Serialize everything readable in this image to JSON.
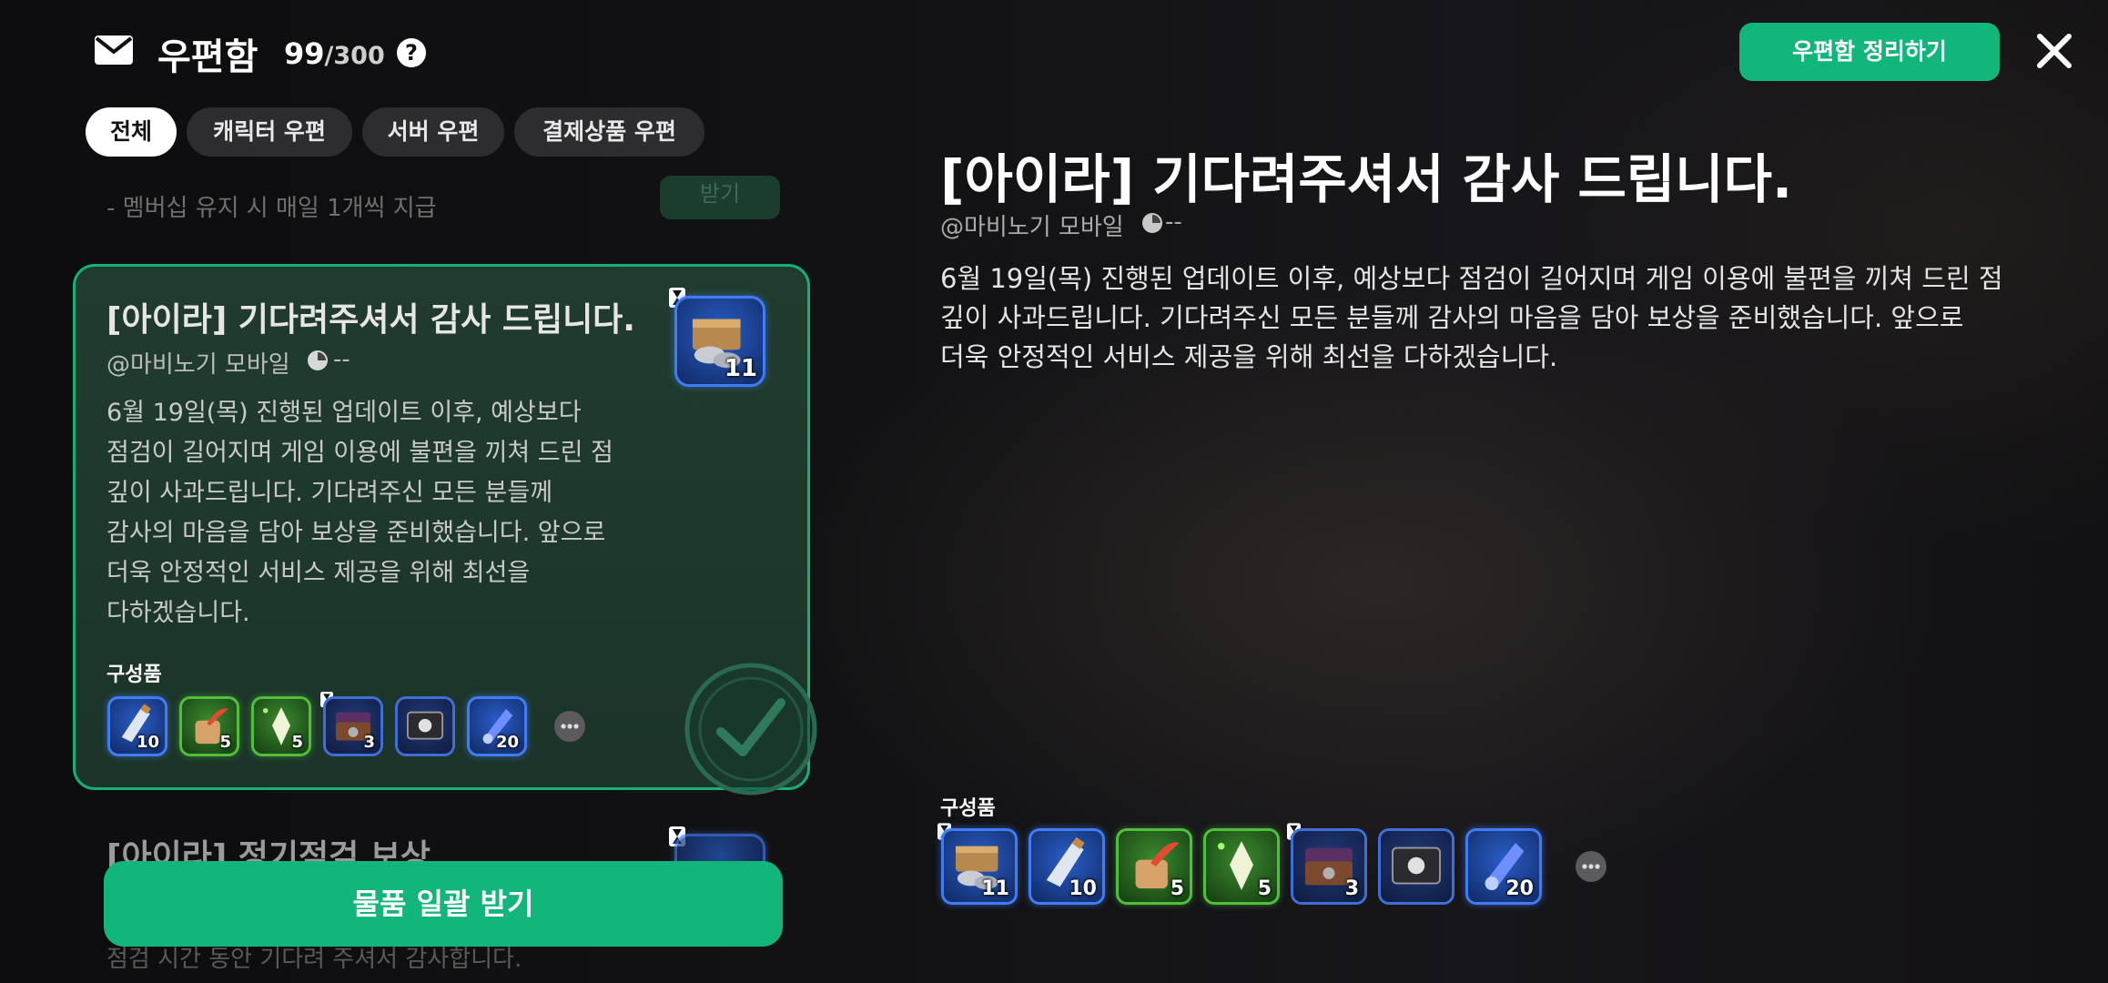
{
  "header": {
    "title": "우편함",
    "count": "99",
    "capacity": "/300",
    "organize_label": "우편함 정리하기",
    "icons": [
      "mail-icon",
      "help-icon",
      "close-icon"
    ]
  },
  "tabs": [
    {
      "label": "전체",
      "active": true
    },
    {
      "label": "캐릭터 우편",
      "active": false
    },
    {
      "label": "서버 우편",
      "active": false
    },
    {
      "label": "결제상품 우편",
      "active": false
    }
  ],
  "faded_prev": {
    "text": "- 멤버십 유지 시 매일 1개씩 지급",
    "button": "받기"
  },
  "selected_mail": {
    "title": "[아이라] 기다려주셔서 감사 드립니다.",
    "sender": "@마비노기 모바일",
    "time": "--",
    "body": [
      "6월 19일(목) 진행된 업데이트 이후, 예상보다",
      "점검이 길어지며 게임 이용에 불편을 끼쳐 드린 점",
      "깊이 사과드립니다.  기다려주신 모든 분들께",
      "감사의 마음을 담아 보상을 준비했습니다. 앞으로",
      "더욱 안정적인 서비스 제공을 위해 최선을",
      "다하겠습니다."
    ],
    "thumbnail_qty": "11",
    "components_label": "구성품",
    "items": [
      {
        "name": "potion-bottle-icon",
        "qty": "10",
        "rarity": "blue"
      },
      {
        "name": "feather-pouch-icon",
        "qty": "5",
        "rarity": "green"
      },
      {
        "name": "crystal-shard-icon",
        "qty": "5",
        "rarity": "green"
      },
      {
        "name": "treasure-chest-icon",
        "qty": "3",
        "rarity": "navy",
        "timed": true
      },
      {
        "name": "card-pack-icon",
        "qty": "",
        "rarity": "navy"
      },
      {
        "name": "mana-potion-icon",
        "qty": "20",
        "rarity": "blue"
      }
    ]
  },
  "next_mail": {
    "title": "[아이라] 정기점검 보상",
    "faded_text": "점검 시간 동안 기다려 주셔서 감사합니다."
  },
  "claim_all_label": "물품 일괄 받기",
  "detail": {
    "title": "[아이라] 기다려주셔서 감사 드립니다.",
    "sender": "@마비노기 모바일",
    "time": "--",
    "body": [
      "6월 19일(목) 진행된 업데이트 이후, 예상보다 점검이 길어지며 게임 이용에 불편을 끼쳐 드린 점",
      "깊이 사과드립니다.  기다려주신 모든 분들께 감사의 마음을 담아 보상을 준비했습니다. 앞으로",
      "더욱 안정적인 서비스 제공을 위해 최선을 다하겠습니다."
    ],
    "components_label": "구성품",
    "items": [
      {
        "name": "coin-box-icon",
        "qty": "11",
        "rarity": "blue",
        "timed": true
      },
      {
        "name": "potion-bottle-icon",
        "qty": "10",
        "rarity": "blue"
      },
      {
        "name": "feather-pouch-icon",
        "qty": "5",
        "rarity": "green"
      },
      {
        "name": "crystal-shard-icon",
        "qty": "5",
        "rarity": "green"
      },
      {
        "name": "treasure-chest-icon",
        "qty": "3",
        "rarity": "navy",
        "timed": true
      },
      {
        "name": "card-pack-icon",
        "qty": "",
        "rarity": "navy"
      },
      {
        "name": "mana-potion-icon",
        "qty": "20",
        "rarity": "blue"
      }
    ]
  },
  "colors": {
    "accent_green": "#12b57a",
    "card_border": "#13b07a",
    "rare_blue": "#3f7cf5",
    "uncommon_green": "#4fbf3c"
  }
}
